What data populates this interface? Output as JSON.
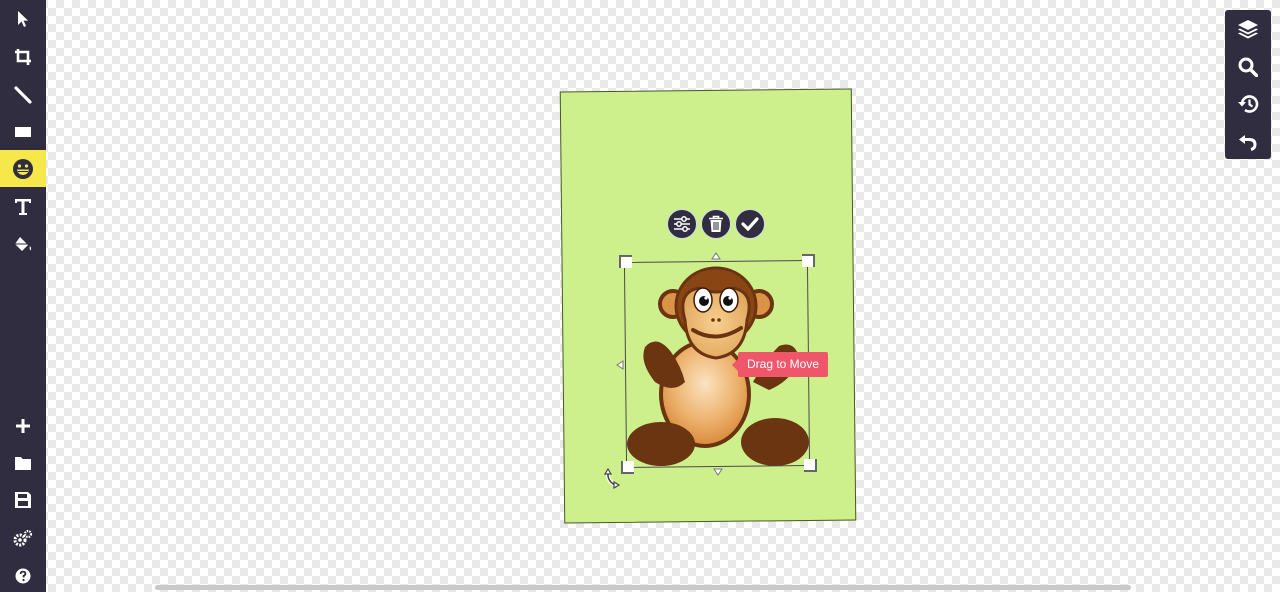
{
  "left_toolbar": {
    "tools": [
      {
        "name": "select",
        "icon": "cursor-arrow-icon"
      },
      {
        "name": "crop",
        "icon": "crop-icon"
      },
      {
        "name": "draw",
        "icon": "pencil-icon"
      },
      {
        "name": "shape",
        "icon": "rectangle-icon"
      },
      {
        "name": "sticker",
        "icon": "grin-emoji-icon",
        "active": true
      },
      {
        "name": "text",
        "icon": "text-icon"
      },
      {
        "name": "fill",
        "icon": "paint-bucket-icon"
      }
    ],
    "bottom_tools": [
      {
        "name": "add",
        "icon": "plus-icon"
      },
      {
        "name": "open",
        "icon": "folder-icon"
      },
      {
        "name": "save",
        "icon": "save-icon"
      },
      {
        "name": "settings",
        "icon": "gears-icon"
      },
      {
        "name": "help",
        "icon": "question-icon"
      }
    ]
  },
  "right_panel": {
    "tools": [
      {
        "name": "layers",
        "icon": "layers-icon"
      },
      {
        "name": "zoom",
        "icon": "search-icon"
      },
      {
        "name": "history",
        "icon": "history-icon"
      },
      {
        "name": "undo",
        "icon": "undo-icon"
      }
    ]
  },
  "canvas": {
    "background_color": "#cdf08d",
    "object_actions": [
      {
        "name": "adjust",
        "icon": "sliders-icon"
      },
      {
        "name": "delete",
        "icon": "trash-icon"
      },
      {
        "name": "apply",
        "icon": "check-icon"
      }
    ],
    "sticker": "monkey-sticker",
    "tooltip": "Drag to Move"
  },
  "colors": {
    "toolbar": "#2f2d3f",
    "active_tool": "#f6e84a",
    "tooltip": "#f0566a"
  }
}
